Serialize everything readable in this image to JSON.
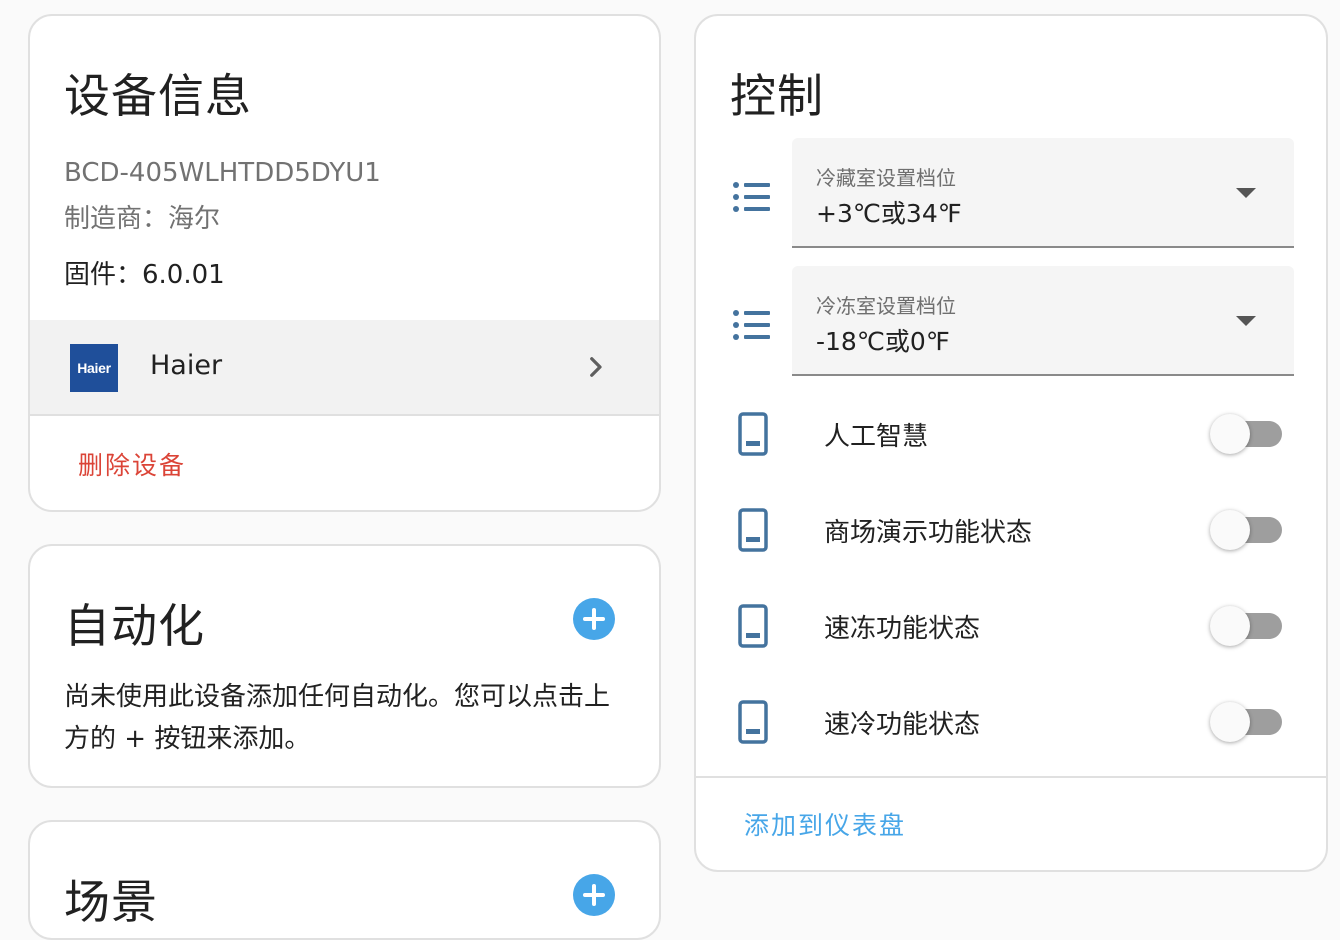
{
  "colors": {
    "accent": "#47a6e8",
    "danger": "#db4437",
    "icon": "#44739e",
    "haier_blue": "#1f4f9a"
  },
  "device_info": {
    "title": "设备信息",
    "model": "BCD-405WLHTDD5DYU1",
    "manufacturer": "制造商：海尔",
    "firmware": "固件：6.0.01",
    "brand_logo_text": "Haier",
    "brand_name": "Haier",
    "delete_label": "删除设备"
  },
  "automation": {
    "title": "自动化",
    "description": "尚未使用此设备添加任何自动化。您可以点击上方的 + 按钮来添加。"
  },
  "third_card": {
    "title": "场景"
  },
  "controls": {
    "title": "控制",
    "selects": [
      {
        "label": "冷藏室设置档位",
        "value": "+3℃或34℉"
      },
      {
        "label": "冷冻室设置档位",
        "value": "-18℃或0℉"
      }
    ],
    "toggles": [
      {
        "label": "人工智慧",
        "state": "off"
      },
      {
        "label": "商场演示功能状态",
        "state": "off"
      },
      {
        "label": "速冻功能状态",
        "state": "off"
      },
      {
        "label": "速冷功能状态",
        "state": "off"
      }
    ],
    "add_to_dashboard": "添加到仪表盘"
  }
}
